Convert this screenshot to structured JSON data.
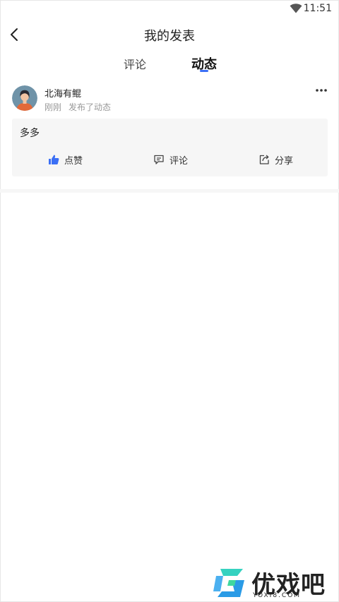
{
  "status_bar": {
    "time": "11:51"
  },
  "header": {
    "title": "我的发表"
  },
  "tabs": [
    {
      "label": "评论",
      "active": false
    },
    {
      "label": "动态",
      "active": true
    }
  ],
  "colors": {
    "accent": "#3b6ff5",
    "like_icon": "#3b6ff5"
  },
  "post": {
    "username": "北海有鲲",
    "time": "刚刚",
    "action_text": "发布了动态",
    "content": "多多",
    "actions": [
      {
        "icon": "thumbs-up-icon",
        "label": "点赞"
      },
      {
        "icon": "comment-icon",
        "label": "评论"
      },
      {
        "icon": "share-icon",
        "label": "分享"
      }
    ]
  },
  "watermark": {
    "text": "优戏吧",
    "sub": "YOXI8.COM"
  }
}
